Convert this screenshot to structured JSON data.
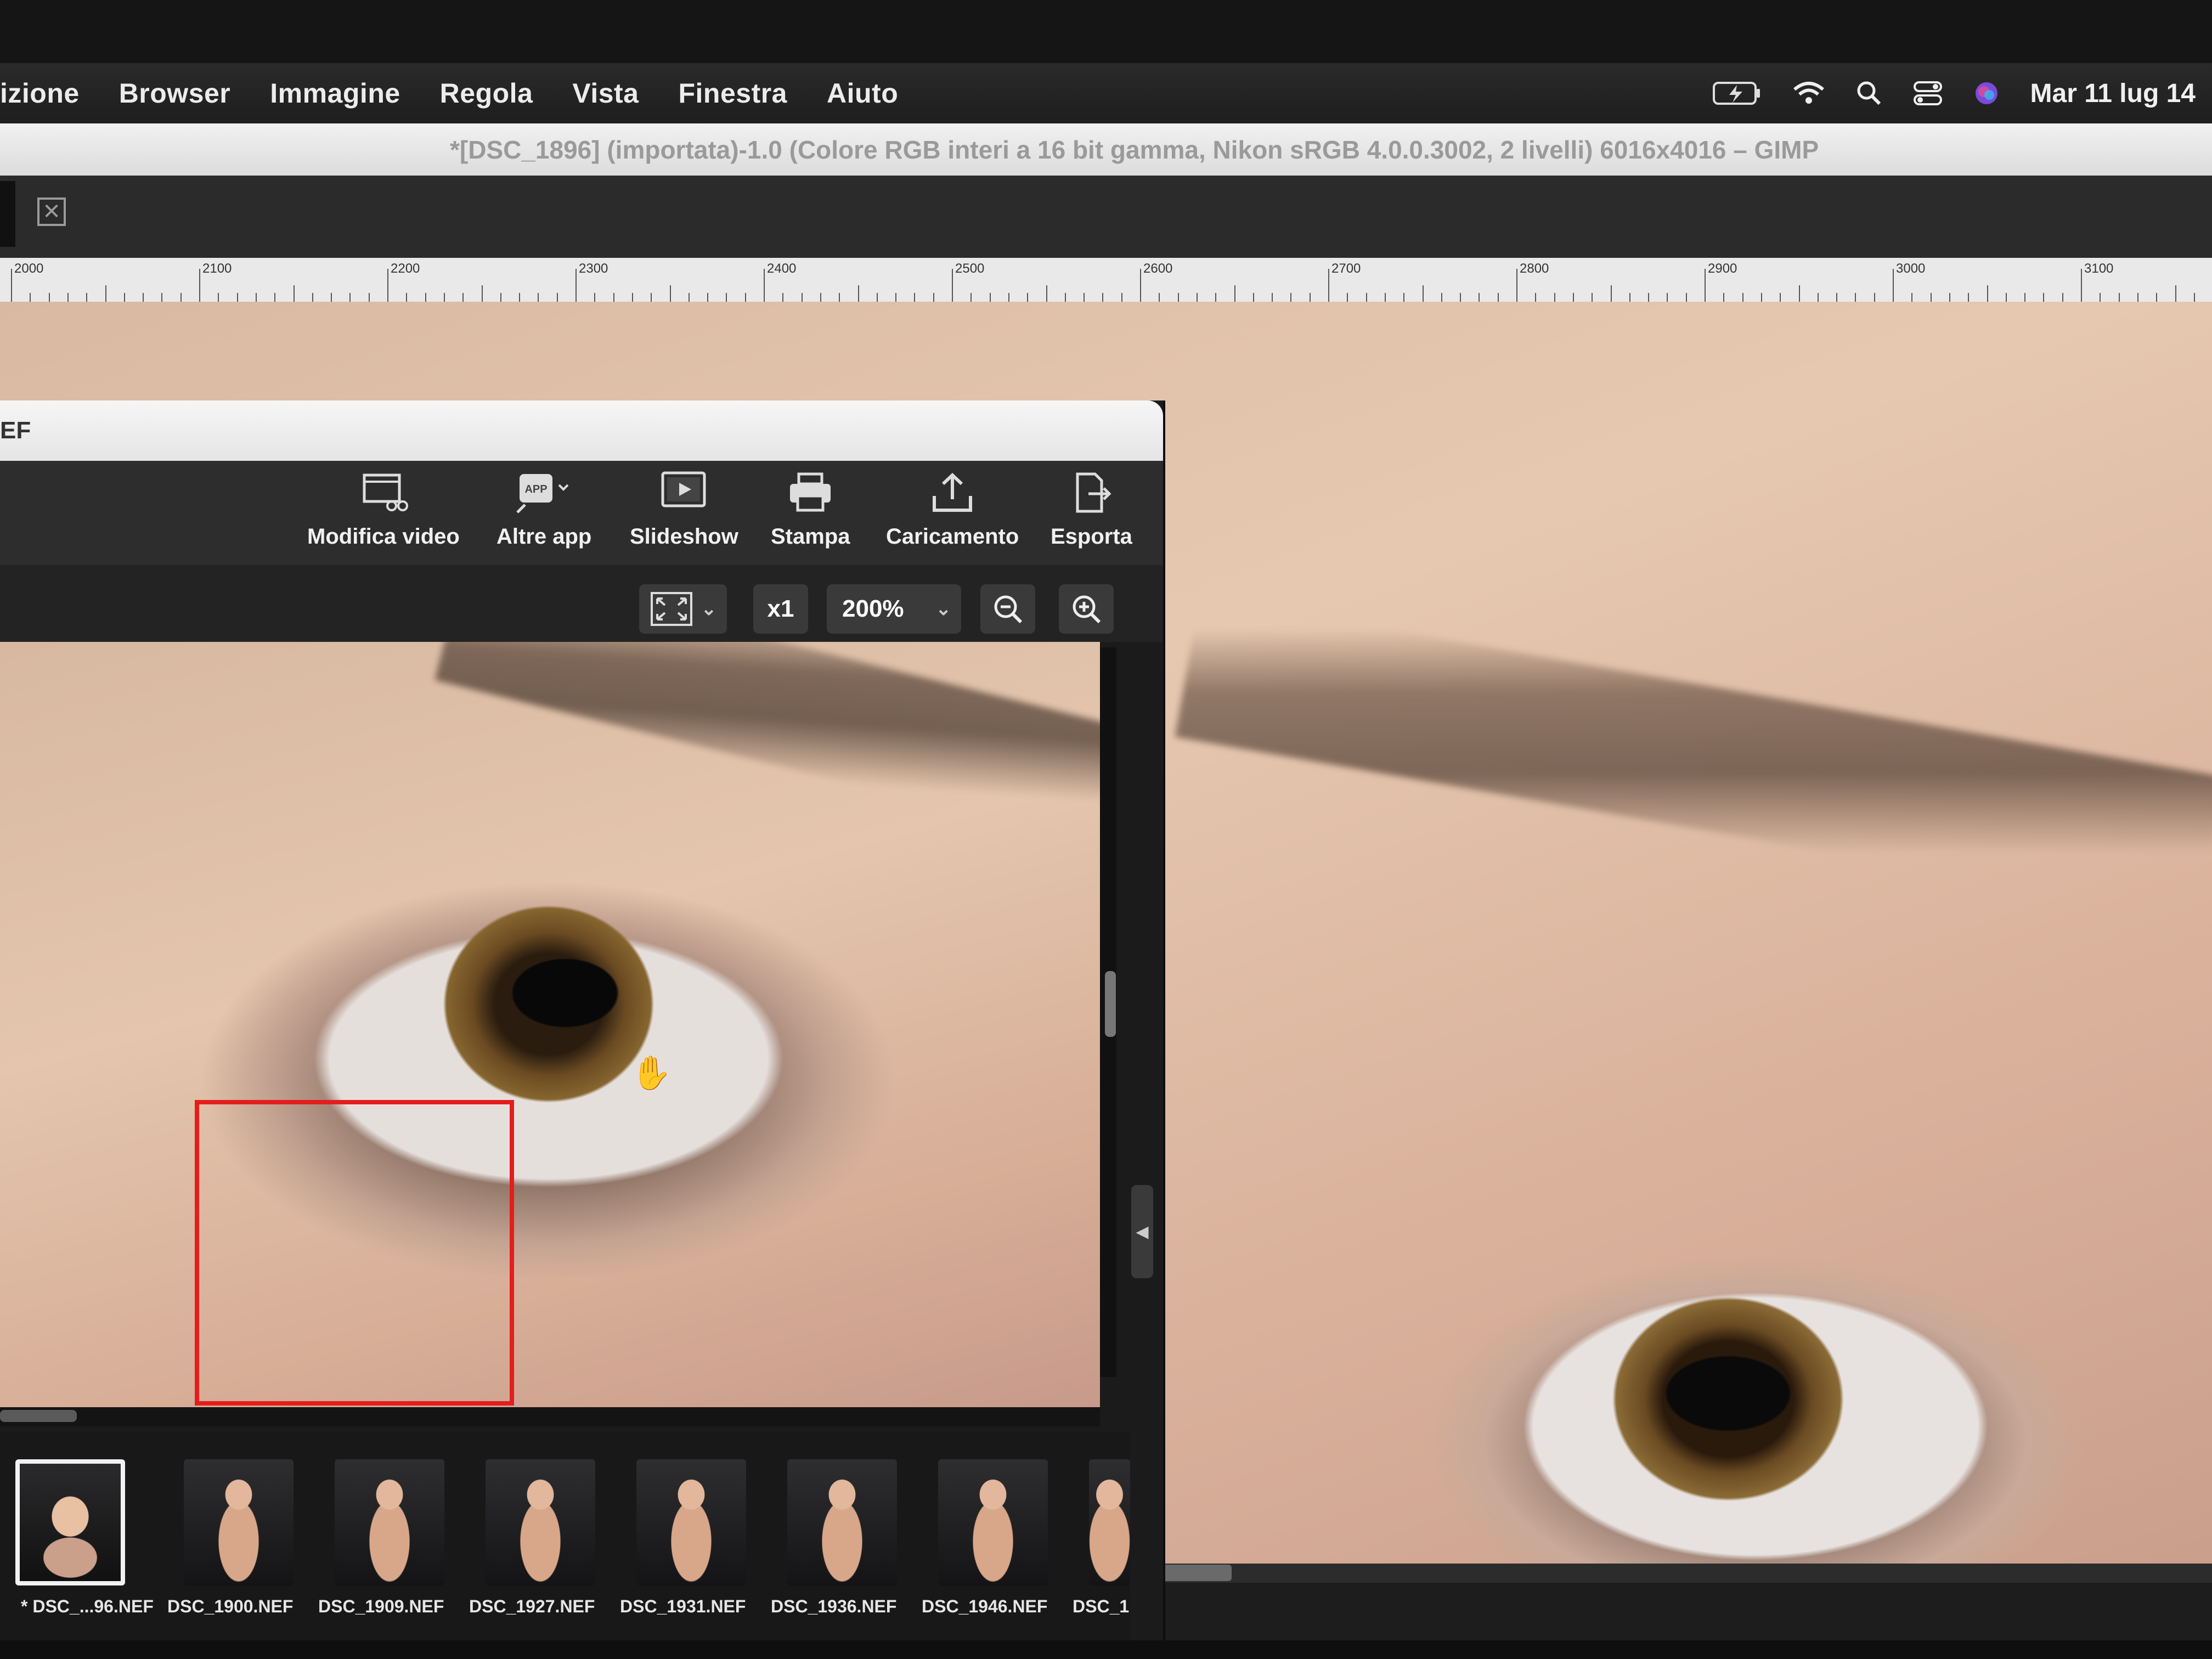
{
  "menubar": {
    "items": [
      "izione",
      "Browser",
      "Immagine",
      "Regola",
      "Vista",
      "Finestra",
      "Aiuto"
    ],
    "clock": "Mar 11 lug",
    "clock_cut": "14"
  },
  "gimp": {
    "title": "*[DSC_1896] (importata)-1.0 (Colore RGB interi a 16 bit gamma, Nikon sRGB 4.0.0.3002, 2 livelli) 6016x4016 – GIMP",
    "ruler_labels": [
      "2000",
      "2100",
      "2200",
      "2300",
      "2400",
      "2500",
      "2600",
      "2700",
      "2800",
      "2900",
      "3000",
      "3100"
    ]
  },
  "viewer": {
    "title_fragment": "EF",
    "toolbar": [
      {
        "label": "Modifica video",
        "icon": "film-scissors-icon"
      },
      {
        "label": "Altre app",
        "icon": "app-icon"
      },
      {
        "label": "Slideshow",
        "icon": "slideshow-icon"
      },
      {
        "label": "Stampa",
        "icon": "print-icon"
      },
      {
        "label": "Caricamento",
        "icon": "upload-icon"
      },
      {
        "label": "Esporta",
        "icon": "export-icon"
      }
    ],
    "app_badge": "APP",
    "zoom": {
      "x1": "x1",
      "level": "200%"
    },
    "filmstrip": [
      {
        "label": "* DSC_...96.NEF",
        "selected": true
      },
      {
        "label": "DSC_1900.NEF",
        "selected": false
      },
      {
        "label": "DSC_1909.NEF",
        "selected": false
      },
      {
        "label": "DSC_1927.NEF",
        "selected": false
      },
      {
        "label": "DSC_1931.NEF",
        "selected": false
      },
      {
        "label": "DSC_1936.NEF",
        "selected": false
      },
      {
        "label": "DSC_1946.NEF",
        "selected": false
      },
      {
        "label": "DSC_1",
        "selected": false
      }
    ]
  },
  "colors": {
    "highlight": "#e41d1d",
    "menubar": "#1e1e1e",
    "toolbar": "#2d2d2d"
  }
}
